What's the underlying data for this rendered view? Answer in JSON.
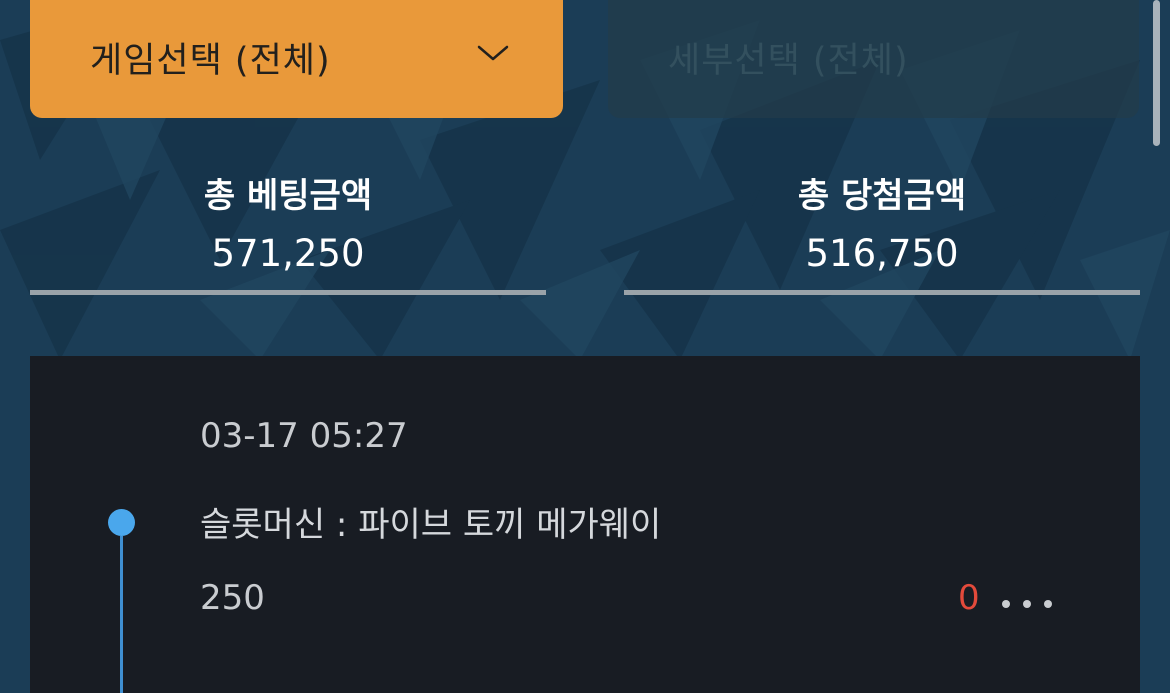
{
  "filters": {
    "game_select": {
      "label": "게임선택 (전체)",
      "icon": "chevron-down-icon",
      "color": "#e9993a"
    },
    "detail_select": {
      "label": "세부선택 (전체)",
      "state": "disabled"
    }
  },
  "summary": {
    "total_bet": {
      "label": "총 베팅금액",
      "value": "571,250"
    },
    "total_win": {
      "label": "총 당첨금액",
      "value": "516,750"
    }
  },
  "history": {
    "entries": [
      {
        "datetime": "03-17 05:27",
        "title": "슬롯머신 : 파이브 토끼 메가웨이",
        "bet": "250",
        "win": "0",
        "more_icon": "more-dots-icon",
        "win_color": "#e34a3b",
        "dot_color": "#4aa7ec"
      }
    ]
  }
}
